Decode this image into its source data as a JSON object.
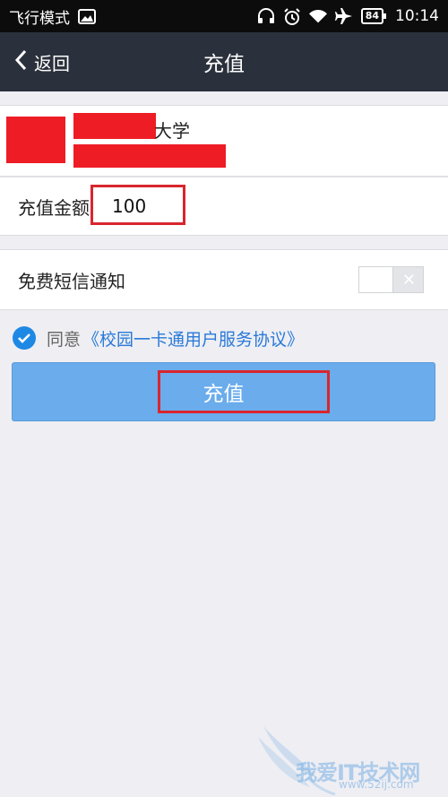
{
  "status_bar": {
    "mode_label": "飞行模式",
    "battery": "84",
    "time": "10:14",
    "icons": [
      "image-icon",
      "headphones-icon",
      "alarm-icon",
      "wifi-icon",
      "airplane-icon",
      "battery-icon"
    ]
  },
  "nav": {
    "back_label": "返回",
    "title": "充值"
  },
  "school": {
    "name_suffix": "大学"
  },
  "amount": {
    "label": "充值金额",
    "value": "100"
  },
  "sms": {
    "label": "免费短信通知",
    "enabled": false
  },
  "agreement": {
    "checked": true,
    "prefix": "同意",
    "link": "《校园一卡通用户服务协议》"
  },
  "submit": {
    "label": "充值"
  },
  "watermark": {
    "text": "我爱IT技术网",
    "url": "www.52ij.com"
  },
  "colors": {
    "navbar": "#2b313c",
    "accent": "#1e88e5",
    "button": "#6aacec",
    "highlight": "#d9262e",
    "redaction": "#ee1c25"
  }
}
